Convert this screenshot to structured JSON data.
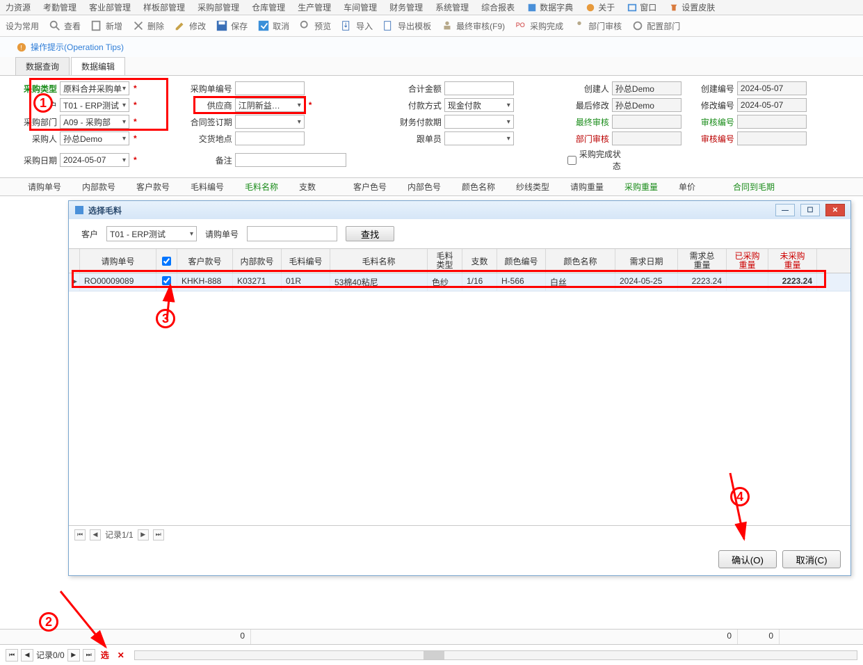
{
  "menu": [
    "力资源",
    "考勤管理",
    "客业部管理",
    "样板部管理",
    "采购部管理",
    "仓库管理",
    "生产管理",
    "车间管理",
    "财务管理",
    "系统管理",
    "综合报表"
  ],
  "menu_icons": [
    {
      "label": "数据字典"
    },
    {
      "label": "关于"
    },
    {
      "label": "窗口"
    },
    {
      "label": "设置皮肤"
    }
  ],
  "toolbar": [
    {
      "label": "设为常用"
    },
    {
      "label": "查看"
    },
    {
      "label": "新增"
    },
    {
      "label": "删除"
    },
    {
      "label": "修改"
    },
    {
      "label": "保存"
    },
    {
      "label": "取消"
    },
    {
      "label": "预览"
    },
    {
      "label": "导入"
    },
    {
      "label": "导出模板"
    },
    {
      "label": "最终审核(F9)"
    },
    {
      "label": "采购完成"
    },
    {
      "label": "部门审核"
    },
    {
      "label": "配置部门"
    }
  ],
  "optips": "操作提示(Operation Tips)",
  "tabs": {
    "query": "数据查询",
    "edit": "数据编辑"
  },
  "form": {
    "l_type": "采购类型",
    "v_type": "原料合并采购单",
    "l_cust": "客户",
    "v_cust": "T01 - ERP测试",
    "l_dept": "采购部门",
    "v_dept": "A09 - 采购部",
    "l_buyer": "采购人",
    "v_buyer": "孙总Demo",
    "l_date": "采购日期",
    "v_date": "2024-05-07",
    "l_pono": "采购单编号",
    "v_pono": "",
    "l_supp": "供应商",
    "v_supp": "江阴新益…",
    "l_sign": "合同签订期",
    "v_sign": "",
    "l_deliv": "交货地点",
    "v_deliv": "",
    "l_remark": "备注",
    "v_remark": "",
    "l_total": "合计金额",
    "v_total": "",
    "l_pay": "付款方式",
    "v_pay": "现金付款",
    "l_finpay": "财务付款期",
    "v_finpay": "",
    "l_follow": "跟单员",
    "v_follow": "",
    "l_creator": "创建人",
    "v_creator": "孙总Demo",
    "l_modifier": "最后修改",
    "v_modifier": "孙总Demo",
    "l_final": "最终审核",
    "v_final": "",
    "l_deptchk": "部门审核",
    "v_deptchk": "",
    "l_created": "创建编号",
    "v_created": "2024-05-07",
    "l_modno": "修改编号",
    "v_modno": "2024-05-07",
    "l_chkno": "审核编号",
    "v_chkno": "",
    "l_chkno2": "审核编号",
    "v_chkno2": "",
    "l_done": "采购完成状态"
  },
  "gridcols": [
    "请购单号",
    "内部款号",
    "客户款号",
    "毛料编号",
    "毛料名称",
    "支数",
    "客户色号",
    "内部色号",
    "颜色名称",
    "纱线类型",
    "请购重量",
    "采购重量",
    "单价",
    "合同到毛期"
  ],
  "dialog": {
    "title": "选择毛料",
    "l_cust": "客户",
    "v_cust": "T01 - ERP测试",
    "l_req": "请购单号",
    "v_req": "",
    "search": "查找",
    "head": {
      "req": "请购单号",
      "cust": "客户款号",
      "int": "内部款号",
      "code": "毛料编号",
      "name": "毛料名称",
      "type1": "毛料",
      "type2": "类型",
      "zhi": "支数",
      "colc": "颜色编号",
      "coln": "颜色名称",
      "date": "需求日期",
      "tot1": "需求总",
      "tot2": "重量",
      "done1": "已采购",
      "done2": "重量",
      "left1": "未采购",
      "left2": "重量"
    },
    "row": {
      "req": "RO00009089",
      "cust": "KHKH-888",
      "int": "K03271",
      "code": "01R",
      "name": "53棉40粘尼",
      "type": "色纱",
      "zhi": "1/16",
      "colc": "H-566",
      "coln": "白丝",
      "date": "2024-05-25",
      "tot": "2223.24",
      "done": "",
      "left": "2223.24"
    },
    "pager": "记录1/1",
    "ok": "确认(O)",
    "cancel": "取消(C)"
  },
  "bottom": {
    "t1": "0",
    "t2": "0",
    "t3": "0",
    "pager": "记录0/0",
    "sel": "选"
  },
  "annot": {
    "n1": "1",
    "n2": "2",
    "n3": "3",
    "n4": "4"
  }
}
